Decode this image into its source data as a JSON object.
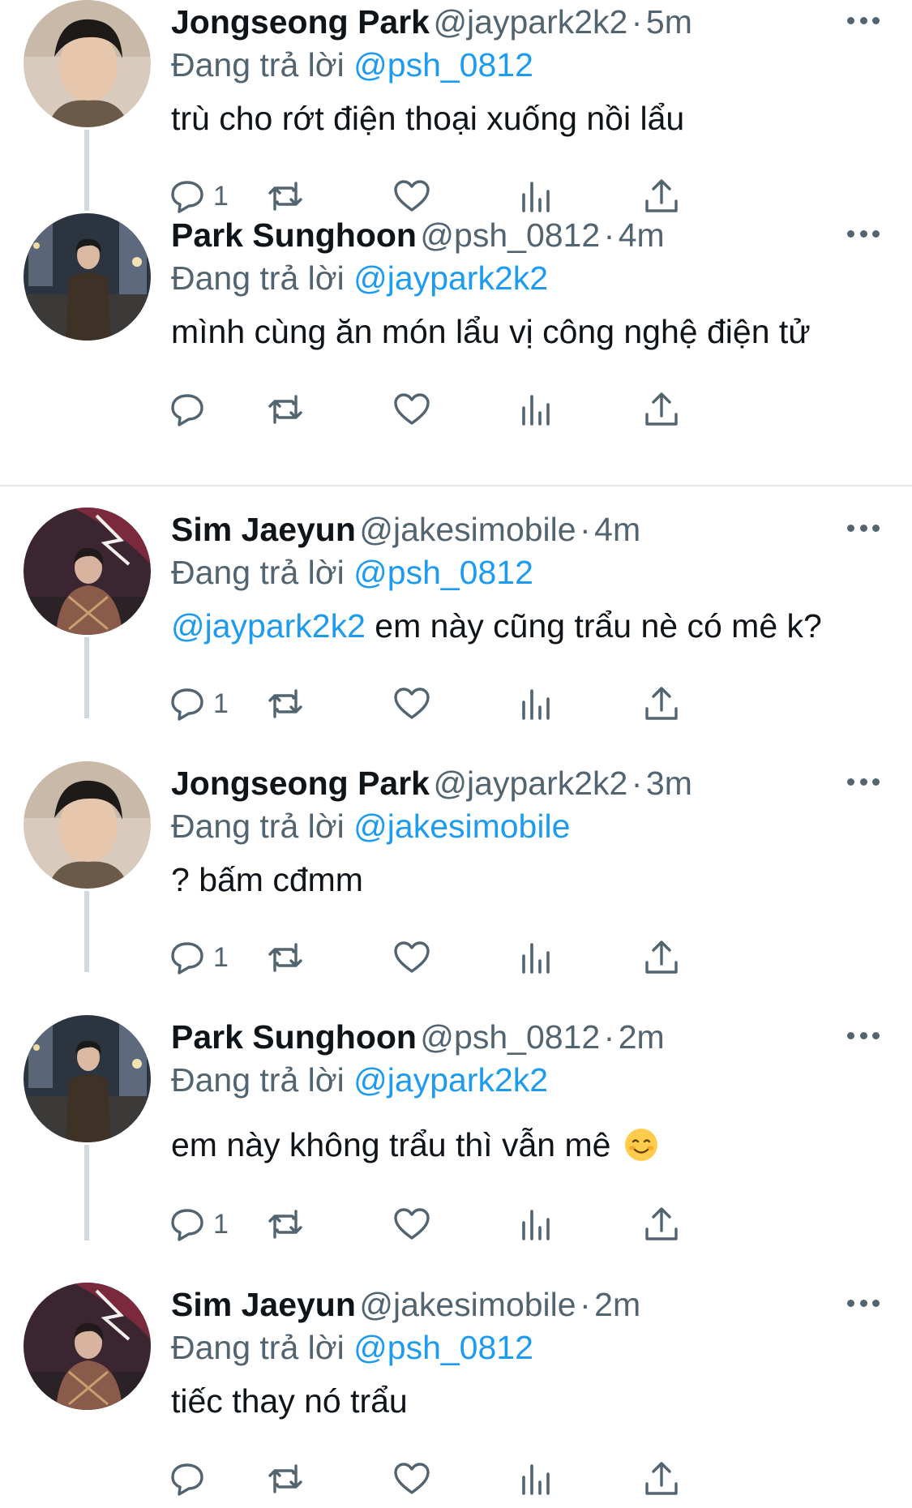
{
  "colors": {
    "accent": "#1d9bf0",
    "secondary_text": "#536471",
    "primary_text": "#0f1419",
    "thread_line": "#cfd9de"
  },
  "replying_prefix": "Đang trả lời",
  "tweets": [
    {
      "name": "Jongseong Park",
      "handle": "@jaypark2k2",
      "dot": "·",
      "time": "5m",
      "reply_to": "@psh_0812",
      "text": "trù cho rớt điện thoại xuống nồi lẩu",
      "reply_count": "1",
      "avatar": "avatar-jongseong"
    },
    {
      "name": "Park Sunghoon",
      "handle": "@psh_0812",
      "dot": "·",
      "time": "4m",
      "reply_to": "@jaypark2k2",
      "text": "mình cùng ăn món lẩu vị công nghệ điện tử",
      "reply_count": "",
      "avatar": "avatar-sunghoon"
    },
    {
      "name": "Sim Jaeyun",
      "handle": "@jakesimobile",
      "dot": "·",
      "time": "4m",
      "reply_to": "@psh_0812",
      "text_mention": "@jaypark2k2",
      "text": " em này cũng trẩu nè có mê k?",
      "reply_count": "1",
      "avatar": "avatar-jaeyun"
    },
    {
      "name": "Jongseong Park",
      "handle": "@jaypark2k2",
      "dot": "·",
      "time": "3m",
      "reply_to": "@jakesimobile",
      "text": "? bấm cđmm",
      "reply_count": "1",
      "avatar": "avatar-jongseong"
    },
    {
      "name": "Park Sunghoon",
      "handle": "@psh_0812",
      "dot": "·",
      "time": "2m",
      "reply_to": "@jaypark2k2",
      "text": "em này không trẩu thì vẫn mê",
      "emoji": "smiling-face-emoji",
      "reply_count": "1",
      "avatar": "avatar-sunghoon"
    },
    {
      "name": "Sim Jaeyun",
      "handle": "@jakesimobile",
      "dot": "·",
      "time": "2m",
      "reply_to": "@psh_0812",
      "text": "tiếc thay nó trẩu",
      "reply_count": "",
      "avatar": "avatar-jaeyun"
    }
  ],
  "icons": {
    "reply": "reply-icon",
    "retweet": "retweet-icon",
    "like": "heart-icon",
    "analytics": "analytics-icon",
    "share": "share-icon",
    "more": "more-icon"
  }
}
